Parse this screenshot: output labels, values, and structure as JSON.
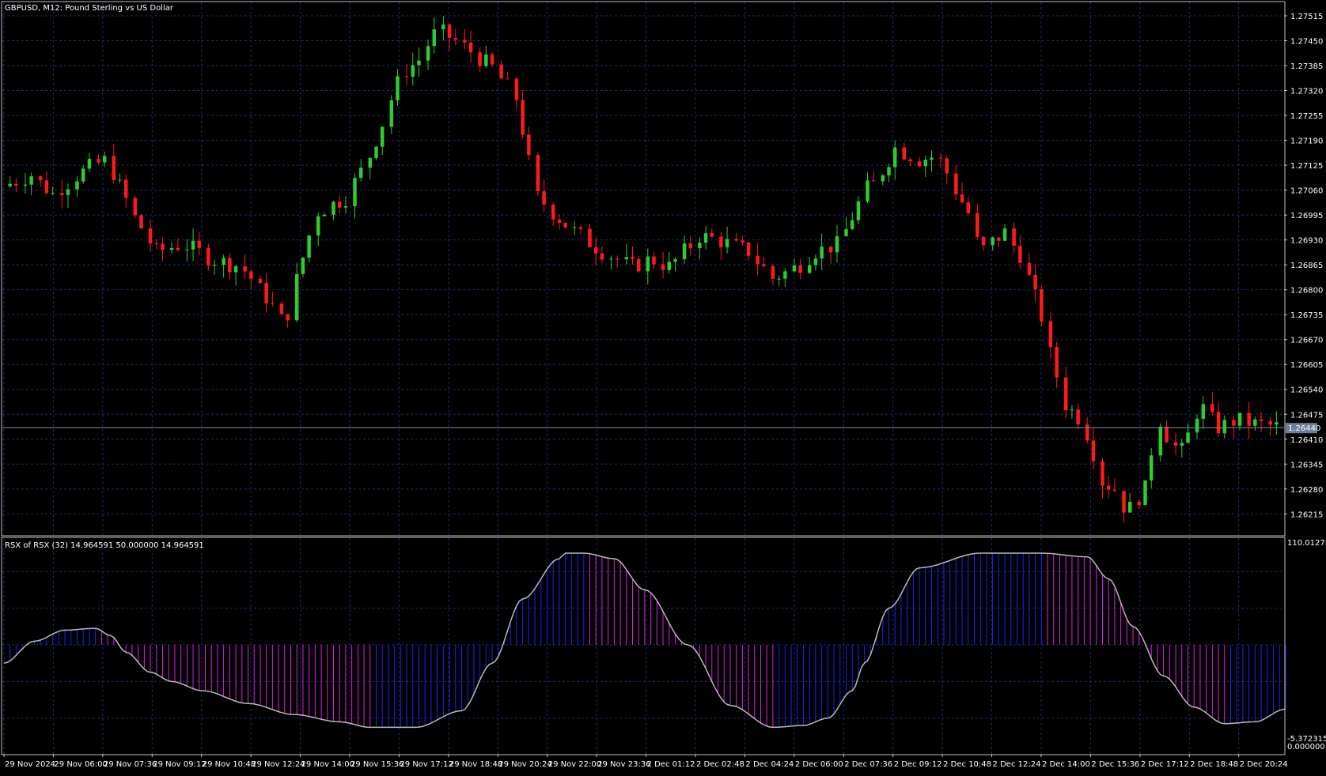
{
  "window": {
    "title": "GBPUSD, M12:  Pound Sterling vs US Dollar",
    "indicator_title": "RSX of RSX (32) 14.964591 50.000000 14.964591"
  },
  "colors": {
    "background": "#000000",
    "grid": "#1f2a6b",
    "frame": "#c0c0c0",
    "bull": "#2ecc2e",
    "bear": "#ff1a1a",
    "wick": "#aaaaaa",
    "price_line": "#7a8fa6",
    "rsx_line": "#b9b9b9",
    "hist_up": "#2020ff",
    "hist_down": "#e020e0",
    "price_tag_bg": "#6d7f96"
  },
  "chart_data": [
    {
      "type": "candlestick",
      "symbol": "GBPUSD",
      "timeframe": "M12",
      "title": "GBPUSD, M12:  Pound Sterling vs US Dollar",
      "ylim": [
        1.2616,
        1.2755
      ],
      "y_ticks": [
        "1.27515",
        "1.27450",
        "1.27385",
        "1.27320",
        "1.27255",
        "1.27190",
        "1.27125",
        "1.27060",
        "1.26995",
        "1.26930",
        "1.26865",
        "1.26800",
        "1.26735",
        "1.26670",
        "1.26605",
        "1.26540",
        "1.26475",
        "1.26410",
        "1.26345",
        "1.26280",
        "1.26215"
      ],
      "x_ticks": [
        "29 Nov 2024",
        "29 Nov 06:00",
        "29 Nov 07:36",
        "29 Nov 09:12",
        "29 Nov 10:48",
        "29 Nov 12:24",
        "29 Nov 14:00",
        "29 Nov 15:36",
        "29 Nov 17:12",
        "29 Nov 18:48",
        "29 Nov 20:24",
        "29 Nov 22:00",
        "29 Nov 23:36",
        "2 Dec 01:12",
        "2 Dec 02:48",
        "2 Dec 04:24",
        "2 Dec 06:00",
        "2 Dec 07:36",
        "2 Dec 09:12",
        "2 Dec 10:48",
        "2 Dec 12:24",
        "2 Dec 14:00",
        "2 Dec 15:36",
        "2 Dec 17:12",
        "2 Dec 18:48",
        "2 Dec 20:24"
      ],
      "current_price": "1.26440",
      "current_price_value": 1.2644,
      "close_path": [
        [
          0,
          1.2707
        ],
        [
          9,
          1.271
        ],
        [
          16,
          1.2705
        ],
        [
          28,
          1.2712
        ],
        [
          34,
          1.2714
        ],
        [
          42,
          1.27
        ],
        [
          50,
          1.269
        ],
        [
          59,
          1.2692
        ],
        [
          68,
          1.2688
        ],
        [
          78,
          1.2686
        ],
        [
          86,
          1.2678
        ],
        [
          92,
          1.2671
        ],
        [
          102,
          1.27
        ],
        [
          112,
          1.2704
        ],
        [
          120,
          1.2715
        ],
        [
          130,
          1.2736
        ],
        [
          136,
          1.274
        ],
        [
          142,
          1.2748
        ],
        [
          150,
          1.2744
        ],
        [
          160,
          1.2738
        ],
        [
          168,
          1.273
        ],
        [
          174,
          1.2705
        ],
        [
          184,
          1.2697
        ],
        [
          196,
          1.269
        ],
        [
          206,
          1.2686
        ],
        [
          212,
          1.2688
        ],
        [
          218,
          1.2686
        ],
        [
          228,
          1.2694
        ],
        [
          234,
          1.2693
        ],
        [
          244,
          1.269
        ],
        [
          252,
          1.2683
        ],
        [
          260,
          1.2686
        ],
        [
          266,
          1.269
        ],
        [
          274,
          1.2692
        ],
        [
          282,
          1.2706
        ],
        [
          286,
          1.2708
        ],
        [
          292,
          1.2717
        ],
        [
          300,
          1.2714
        ],
        [
          306,
          1.2715
        ],
        [
          316,
          1.27
        ],
        [
          320,
          1.269
        ],
        [
          328,
          1.2695
        ],
        [
          334,
          1.2688
        ],
        [
          340,
          1.2673
        ],
        [
          344,
          1.266
        ],
        [
          348,
          1.265
        ],
        [
          354,
          1.2645
        ],
        [
          360,
          1.263
        ],
        [
          364,
          1.2628
        ],
        [
          368,
          1.2622
        ],
        [
          374,
          1.2628
        ],
        [
          378,
          1.2648
        ],
        [
          382,
          1.264
        ],
        [
          386,
          1.2638
        ],
        [
          392,
          1.265
        ],
        [
          398,
          1.2644
        ],
        [
          404,
          1.2646
        ],
        [
          410,
          1.2645
        ],
        [
          420,
          1.2644
        ]
      ]
    },
    {
      "type": "line",
      "name": "RSX of RSX (32)",
      "values_label": "14.964591 50.000000 14.964591",
      "ylim": [
        -5.372315,
        110.012754
      ],
      "y_ticks": [
        "110.012754",
        "-5.372315",
        "0.000000"
      ],
      "level": 50,
      "x": [
        0,
        10,
        20,
        30,
        35,
        40,
        48,
        55,
        65,
        80,
        95,
        110,
        120,
        135,
        150,
        160,
        170,
        182,
        184,
        190,
        200,
        210,
        224,
        238,
        252,
        262,
        270,
        278,
        282,
        290,
        300,
        320,
        340,
        355,
        362,
        370,
        380,
        390,
        400,
        410,
        420
      ],
      "y": [
        40,
        52,
        58,
        59,
        55,
        46,
        35,
        30,
        25,
        18,
        12,
        8,
        5,
        5,
        14,
        40,
        75,
        97,
        100,
        100,
        97,
        80,
        50,
        17,
        5,
        6,
        10,
        25,
        40,
        70,
        92,
        100,
        100,
        98,
        86,
        60,
        33,
        16,
        7,
        8,
        15
      ]
    }
  ]
}
